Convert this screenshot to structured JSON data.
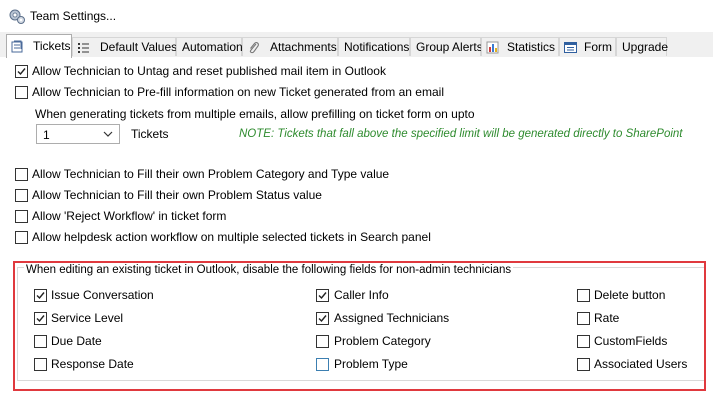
{
  "window": {
    "title": "Team Settings..."
  },
  "tabs": [
    {
      "label": "Tickets",
      "icon": "ticket-icon",
      "active": true
    },
    {
      "label": "Default Values",
      "icon": "list-icon",
      "active": false
    },
    {
      "label": "Automation",
      "icon": "",
      "active": false
    },
    {
      "label": "Attachments",
      "icon": "paperclip-icon",
      "active": false
    },
    {
      "label": "Notifications",
      "icon": "",
      "active": false
    },
    {
      "label": "Group Alerts",
      "icon": "",
      "active": false
    },
    {
      "label": "Statistics",
      "icon": "bar-chart-icon",
      "active": false
    },
    {
      "label": "Form",
      "icon": "form-icon",
      "active": false
    },
    {
      "label": "Upgrade",
      "icon": "",
      "active": false
    }
  ],
  "options": {
    "untag": {
      "label": "Allow Technician to Untag and reset published mail item in Outlook",
      "checked": true
    },
    "prefill": {
      "label": "Allow Technician to Pre-fill information on new Ticket generated from an email",
      "checked": false
    },
    "prefill_hint": "When generating tickets from multiple emails, allow prefilling on ticket form on upto",
    "ticket_count": {
      "value": "1",
      "unit": "Tickets"
    },
    "note": "NOTE: Tickets that fall above the specified limit will be generated directly to SharePoint",
    "fill_category": {
      "label": "Allow Technician to Fill their own Problem Category and Type value",
      "checked": false
    },
    "fill_status": {
      "label": "Allow Technician to Fill their own Problem Status value",
      "checked": false
    },
    "reject_workflow": {
      "label": "Allow 'Reject Workflow' in ticket form",
      "checked": false
    },
    "multi_workflow": {
      "label": "Allow helpdesk action workflow on multiple selected tickets in Search panel",
      "checked": false
    }
  },
  "disable_fields": {
    "legend": "When editing an existing ticket in Outlook, disable the following fields for non-admin technicians",
    "items": [
      {
        "label": "Issue Conversation",
        "checked": true
      },
      {
        "label": "Caller Info",
        "checked": true
      },
      {
        "label": "Delete button",
        "checked": false
      },
      {
        "label": "Service Level",
        "checked": true
      },
      {
        "label": "Assigned Technicians",
        "checked": true
      },
      {
        "label": "Rate",
        "checked": false
      },
      {
        "label": "Due Date",
        "checked": false
      },
      {
        "label": "Problem Category",
        "checked": false
      },
      {
        "label": "CustomFields",
        "checked": false
      },
      {
        "label": "Response Date",
        "checked": false
      },
      {
        "label": "Problem Type",
        "checked": false,
        "focused": true
      },
      {
        "label": "Associated Users",
        "checked": false
      }
    ]
  }
}
